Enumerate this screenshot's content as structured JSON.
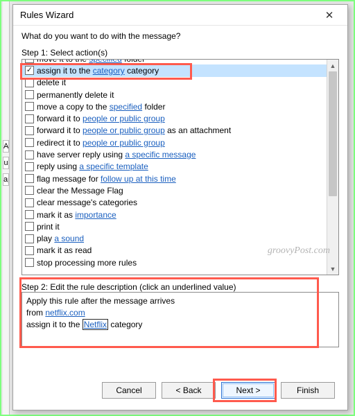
{
  "dialog": {
    "title": "Rules Wizard",
    "prompt": "What do you want to do with the message?",
    "step1_label": "Step 1: Select action(s)",
    "step2_label": "Step 2: Edit the rule description (click an underlined value)"
  },
  "actions": [
    {
      "checked": false,
      "pre": "move it to the ",
      "link": "specified",
      "post": " folder"
    },
    {
      "checked": true,
      "pre": "assign it to the ",
      "link": "category",
      "post": " category",
      "selected": true
    },
    {
      "checked": false,
      "pre": "delete it",
      "link": "",
      "post": ""
    },
    {
      "checked": false,
      "pre": "permanently delete it",
      "link": "",
      "post": ""
    },
    {
      "checked": false,
      "pre": "move a copy to the ",
      "link": "specified",
      "post": " folder"
    },
    {
      "checked": false,
      "pre": "forward it to ",
      "link": "people or public group",
      "post": ""
    },
    {
      "checked": false,
      "pre": "forward it to ",
      "link": "people or public group",
      "post": " as an attachment"
    },
    {
      "checked": false,
      "pre": "redirect it to ",
      "link": "people or public group",
      "post": ""
    },
    {
      "checked": false,
      "pre": "have server reply using ",
      "link": "a specific message",
      "post": ""
    },
    {
      "checked": false,
      "pre": "reply using ",
      "link": "a specific template",
      "post": ""
    },
    {
      "checked": false,
      "pre": "flag message for ",
      "link": "follow up at this time",
      "post": ""
    },
    {
      "checked": false,
      "pre": "clear the Message Flag",
      "link": "",
      "post": ""
    },
    {
      "checked": false,
      "pre": "clear message's categories",
      "link": "",
      "post": ""
    },
    {
      "checked": false,
      "pre": "mark it as ",
      "link": "importance",
      "post": ""
    },
    {
      "checked": false,
      "pre": "print it",
      "link": "",
      "post": ""
    },
    {
      "checked": false,
      "pre": "play ",
      "link": "a sound",
      "post": ""
    },
    {
      "checked": false,
      "pre": "mark it as read",
      "link": "",
      "post": ""
    },
    {
      "checked": false,
      "pre": "stop processing more rules",
      "link": "",
      "post": ""
    }
  ],
  "description": {
    "line1": "Apply this rule after the message arrives",
    "line2_pre": "from ",
    "line2_link": "netflix.com",
    "line3_pre": "assign it to the ",
    "line3_link": "Netflix",
    "line3_post": " category"
  },
  "buttons": {
    "cancel": "Cancel",
    "back": "< Back",
    "next": "Next >",
    "finish": "Finish"
  },
  "watermark": "groovyPost.com"
}
